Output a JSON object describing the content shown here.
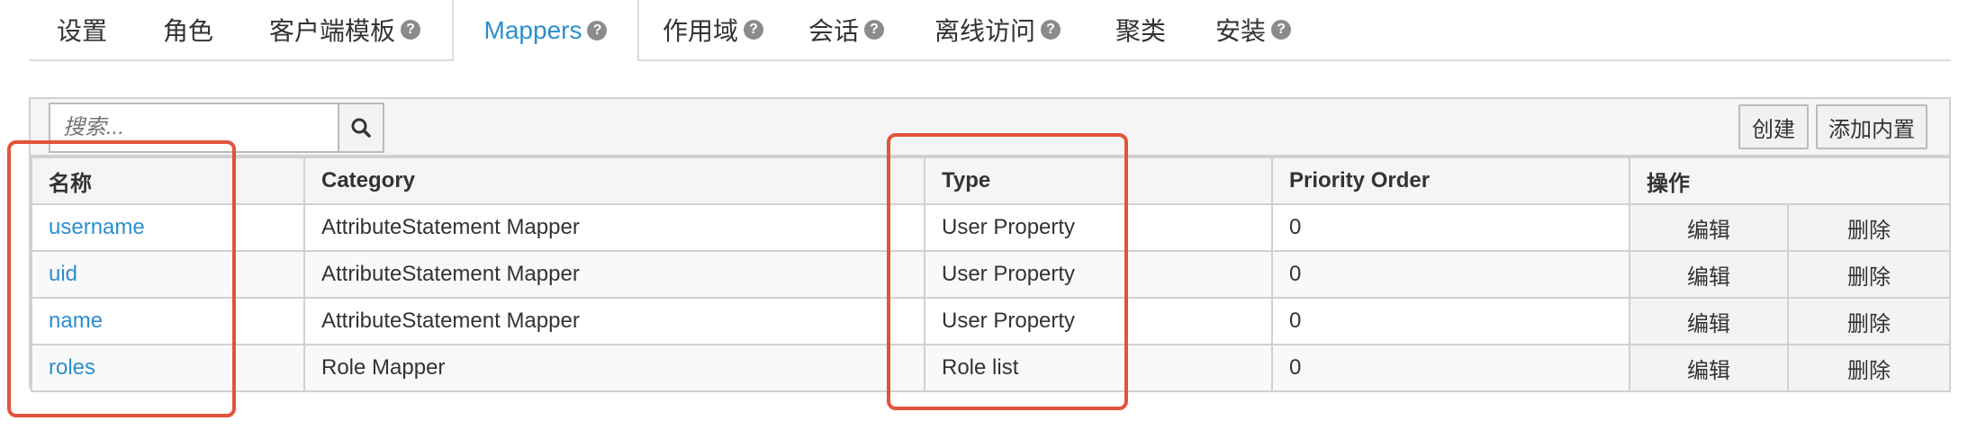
{
  "tabs": [
    {
      "label": "设置",
      "help": false,
      "active": false
    },
    {
      "label": "角色",
      "help": false,
      "active": false
    },
    {
      "label": "客户端模板",
      "help": true,
      "active": false
    },
    {
      "label": "Mappers",
      "help": true,
      "active": true
    },
    {
      "label": "作用域",
      "help": true,
      "active": false
    },
    {
      "label": "会话",
      "help": true,
      "active": false
    },
    {
      "label": "离线访问",
      "help": true,
      "active": false
    },
    {
      "label": "聚类",
      "help": false,
      "active": false
    },
    {
      "label": "安装",
      "help": true,
      "active": false
    }
  ],
  "help_glyph": "?",
  "toolbar": {
    "search_placeholder": "搜索...",
    "create_label": "创建",
    "add_builtin_label": "添加内置"
  },
  "table": {
    "headers": {
      "name": "名称",
      "category": "Category",
      "type": "Type",
      "priority": "Priority Order",
      "actions": "操作"
    },
    "rows": [
      {
        "name": "username",
        "category": "AttributeStatement Mapper",
        "type": "User Property",
        "priority": "0",
        "edit": "编辑",
        "delete": "删除"
      },
      {
        "name": "uid",
        "category": "AttributeStatement Mapper",
        "type": "User Property",
        "priority": "0",
        "edit": "编辑",
        "delete": "删除"
      },
      {
        "name": "name",
        "category": "AttributeStatement Mapper",
        "type": "User Property",
        "priority": "0",
        "edit": "编辑",
        "delete": "删除"
      },
      {
        "name": "roles",
        "category": "Role Mapper",
        "type": "Role list",
        "priority": "0",
        "edit": "编辑",
        "delete": "删除"
      }
    ]
  },
  "colors": {
    "link": "#2b8fcf",
    "highlight": "#e2533a"
  }
}
